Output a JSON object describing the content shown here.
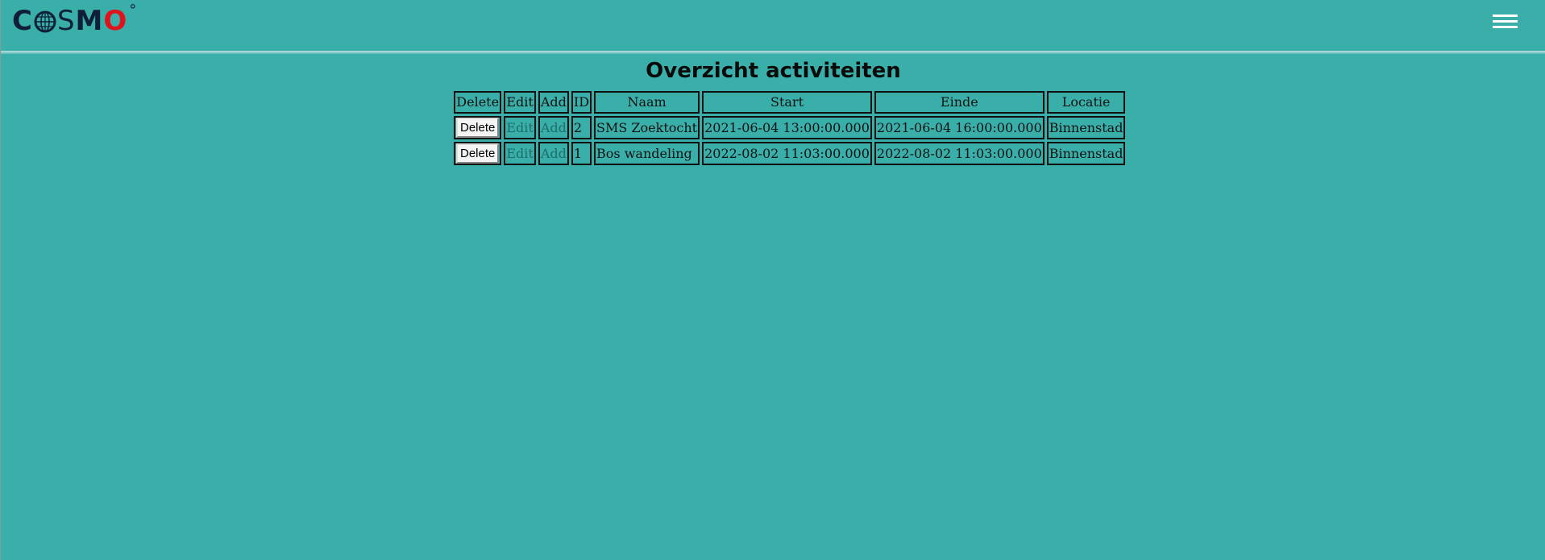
{
  "header": {
    "logo": {
      "c": "C",
      "o1": "O",
      "s": "S",
      "m": "M",
      "o2": "O",
      "deg": "°"
    },
    "menu_icon": "hamburger-menu-icon"
  },
  "main": {
    "title": "Overzicht activiteiten",
    "table": {
      "headers": [
        "Delete",
        "Edit",
        "Add",
        "ID",
        "Naam",
        "Start",
        "Einde",
        "Locatie"
      ],
      "rows": [
        {
          "delete": "Delete",
          "edit": "Edit",
          "add": "Add",
          "id": "2",
          "naam": "SMS Zoektocht",
          "start": "2021-06-04 13:00:00.000",
          "einde": "2021-06-04 16:00:00.000",
          "locatie": "Binnenstad"
        },
        {
          "delete": "Delete",
          "edit": "Edit",
          "add": "Add",
          "id": "1",
          "naam": "Bos wandeling",
          "start": "2022-08-02 11:03:00.000",
          "einde": "2022-08-02 11:03:00.000",
          "locatie": "Binnenstad"
        }
      ]
    }
  },
  "colors": {
    "background": "#3aafa9",
    "logo_dark": "#0f1f3a",
    "logo_red": "#e0131d"
  }
}
